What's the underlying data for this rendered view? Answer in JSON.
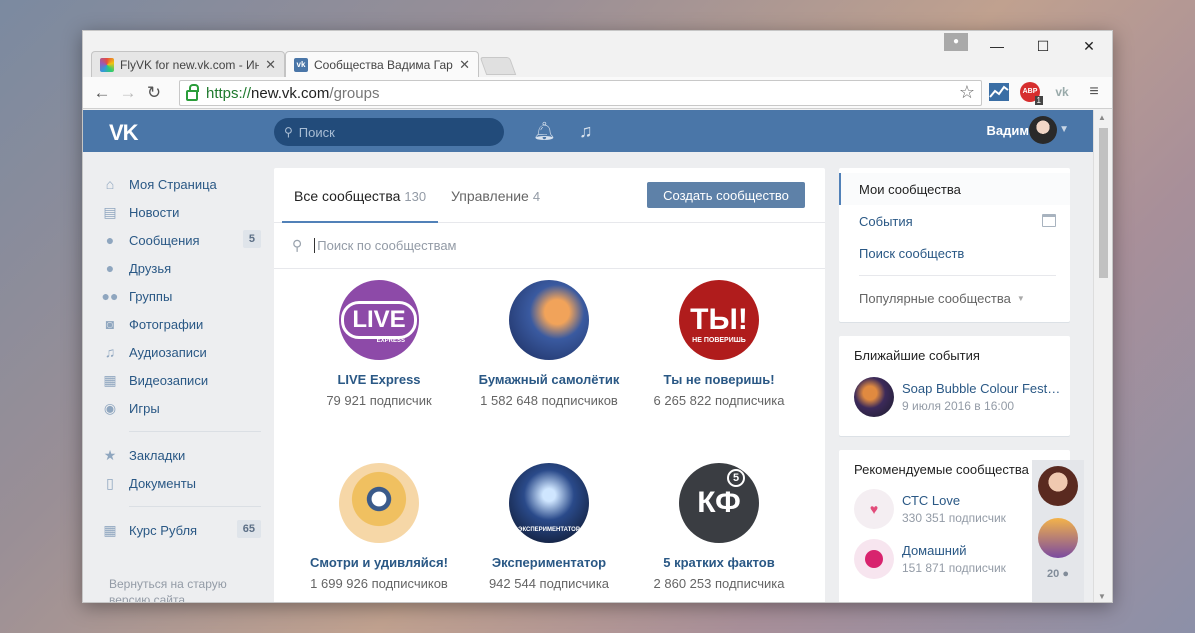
{
  "browser": {
    "tabs": [
      {
        "title": "FlyVK for new.vk.com - Инт",
        "close": "✕"
      },
      {
        "title": "Сообщества Вадима Гар",
        "close": "✕"
      }
    ],
    "window_controls": {
      "minimize": "—",
      "maximize": "☐",
      "close": "✕"
    },
    "url": {
      "scheme": "https://",
      "host": "new.vk.com",
      "path": "/groups"
    },
    "extensions": {
      "abp_label": "ABP",
      "abp_count": "1"
    }
  },
  "vk": {
    "logo": "VK",
    "search_placeholder": "Поиск",
    "user_name": "Вадим",
    "menu": [
      {
        "icon": "home-icon",
        "glyph": "⌂",
        "label": "Моя Страница",
        "badge": ""
      },
      {
        "icon": "news-icon",
        "glyph": "▤",
        "label": "Новости",
        "badge": ""
      },
      {
        "icon": "messages-icon",
        "glyph": "●",
        "label": "Сообщения",
        "badge": "5"
      },
      {
        "icon": "friends-icon",
        "glyph": "●",
        "label": "Друзья",
        "badge": ""
      },
      {
        "icon": "groups-icon",
        "glyph": "●●",
        "label": "Группы",
        "badge": ""
      },
      {
        "icon": "photos-icon",
        "glyph": "◙",
        "label": "Фотографии",
        "badge": ""
      },
      {
        "icon": "music-icon",
        "glyph": "♫",
        "label": "Аудиозаписи",
        "badge": ""
      },
      {
        "icon": "video-icon",
        "glyph": "▦",
        "label": "Видеозаписи",
        "badge": ""
      },
      {
        "icon": "games-icon",
        "glyph": "◉",
        "label": "Игры",
        "badge": ""
      }
    ],
    "menu2": [
      {
        "icon": "bookmarks-icon",
        "glyph": "★",
        "label": "Закладки",
        "badge": ""
      },
      {
        "icon": "documents-icon",
        "glyph": "▯",
        "label": "Документы",
        "badge": ""
      }
    ],
    "menu3": [
      {
        "icon": "app-icon",
        "glyph": "▦",
        "label": "Курс Рубля",
        "badge": "65"
      }
    ],
    "footer_link": "Вернуться на старую версию сайта"
  },
  "groups": {
    "tab_all": {
      "label": "Все сообщества",
      "count": "130"
    },
    "tab_manage": {
      "label": "Управление",
      "count": "4"
    },
    "create_button": "Создать сообщество",
    "search_placeholder": "Поиск по сообществам",
    "cards": [
      {
        "name": "LIVE Express",
        "subs": "79 921 подписчик",
        "avatar_text": "LIVE",
        "avatar_sub": "EXPRESS"
      },
      {
        "name": "Бумажный самолётик",
        "subs": "1 582 648 подписчиков",
        "avatar_text": "",
        "avatar_sub": ""
      },
      {
        "name": "Ты не поверишь!",
        "subs": "6 265 822 подписчика",
        "avatar_text": "ТЫ!",
        "avatar_sub": "НЕ ПОВЕРИШЬ"
      },
      {
        "name": "Смотри и удивляйся!",
        "subs": "1 699 926 подписчиков",
        "avatar_text": "",
        "avatar_sub": ""
      },
      {
        "name": "Экспериментатор",
        "subs": "942 544 подписчика",
        "avatar_text": "ЭКСПЕРИМЕНТАТОР",
        "avatar_sub": ""
      },
      {
        "name": "5 кратких фактов",
        "subs": "2 860 253 подписчика",
        "avatar_text": "КФ",
        "avatar_sub": "5"
      }
    ]
  },
  "right": {
    "nav": [
      {
        "label": "Мои сообщества"
      },
      {
        "label": "События"
      },
      {
        "label": "Поиск сообществ"
      }
    ],
    "popular": "Популярные сообщества",
    "events_title": "Ближайшие события",
    "event": {
      "name": "Soap Bubble Colour Fest…",
      "date": "9 июля 2016 в 16:00"
    },
    "recommended_title": "Рекомендуемые сообщества",
    "recommended": [
      {
        "name": "СТС Love",
        "subs": "330 351 подписчик"
      },
      {
        "name": "Домашний",
        "subs": "151 871 подписчик"
      }
    ],
    "friends_count": "20"
  }
}
